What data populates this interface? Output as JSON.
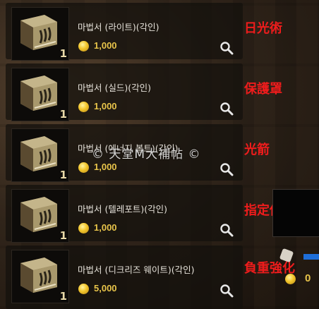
{
  "items": [
    {
      "name": "마법서 (라이트)(각인)",
      "price": "1,000",
      "quantity": "1",
      "icon": "spellbook-icon"
    },
    {
      "name": "마법서 (실드)(각인)",
      "price": "1,000",
      "quantity": "1",
      "icon": "spellbook-icon"
    },
    {
      "name": "마법서 (에너지 볼트)(각인)",
      "price": "1,000",
      "quantity": "1",
      "icon": "spellbook-icon"
    },
    {
      "name": "마법서 (텔레포트)(각인)",
      "price": "1,000",
      "quantity": "1",
      "icon": "spellbook-icon"
    },
    {
      "name": "마법서 (디크리즈 웨이트)(각인)",
      "price": "5,000",
      "quantity": "1",
      "icon": "spellbook-icon"
    }
  ],
  "annotations": [
    "日光術",
    "保護罩",
    "光箭",
    "指定傳送",
    "負重強化"
  ],
  "watermark": "© 天堂M大補帖 ©",
  "side_panel": {
    "price": "0"
  },
  "colors": {
    "annotation": "#ee1c1c",
    "price": "#e8c44a",
    "item_name": "#e6e2da",
    "row_bg": "rgba(20,16,12,0.72)",
    "side_bar": "#1e6ed8"
  }
}
